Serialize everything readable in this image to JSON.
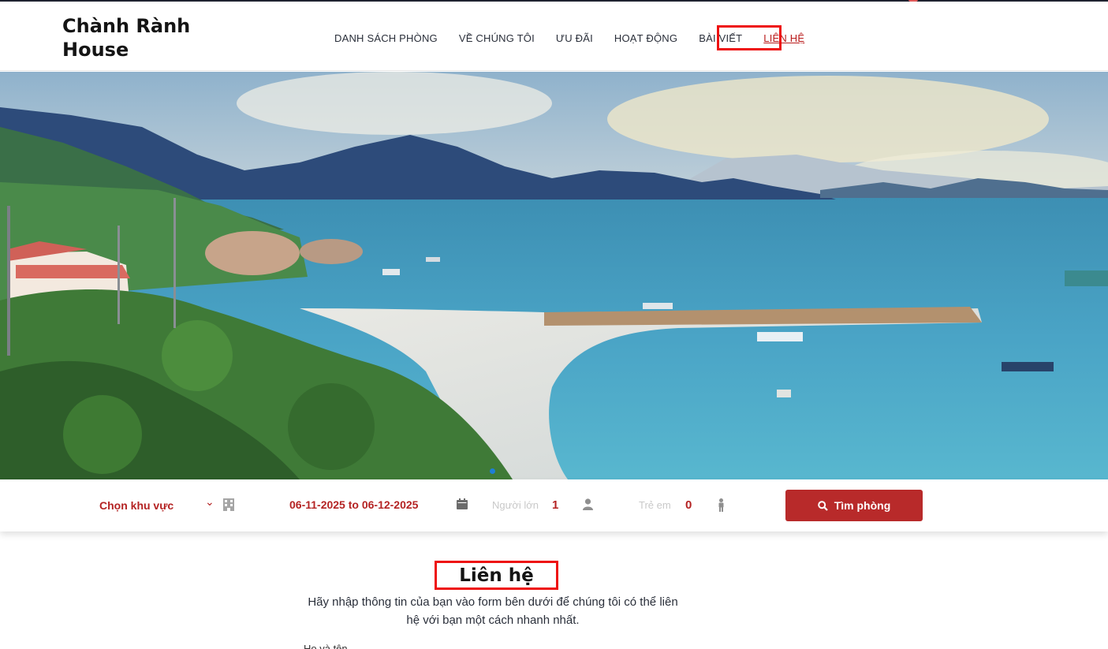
{
  "brand": {
    "name": "Chành Rành House"
  },
  "nav": {
    "items": [
      {
        "label": "DANH SÁCH PHÒNG"
      },
      {
        "label": "VỀ CHÚNG TÔI"
      },
      {
        "label": "ƯU ĐÃI"
      },
      {
        "label": "HOẠT ĐỘNG"
      },
      {
        "label": "BÀI VIẾT"
      },
      {
        "label": "LIÊN HỆ",
        "active": true
      }
    ]
  },
  "hero": {
    "carousel_active_index": 1
  },
  "search": {
    "region_value": "Chọn khu vực",
    "date_range": "06-11-2025 to 06-12-2025",
    "adults_label": "Người lớn",
    "adults_value": "1",
    "children_label": "Trẻ em",
    "children_value": "0",
    "button_label": "Tìm phòng"
  },
  "contact": {
    "title": "Liên hệ",
    "description": "Hãy nhập thông tin của bạn vào form bên dưới để chúng tôi có thể liên hệ với bạn một cách nhanh nhất.",
    "next_label": "Họ và tên"
  },
  "colors": {
    "accent": "#b82a2a",
    "highlight_box": "#ee1111",
    "carousel_dot": "#1e7fd6"
  }
}
